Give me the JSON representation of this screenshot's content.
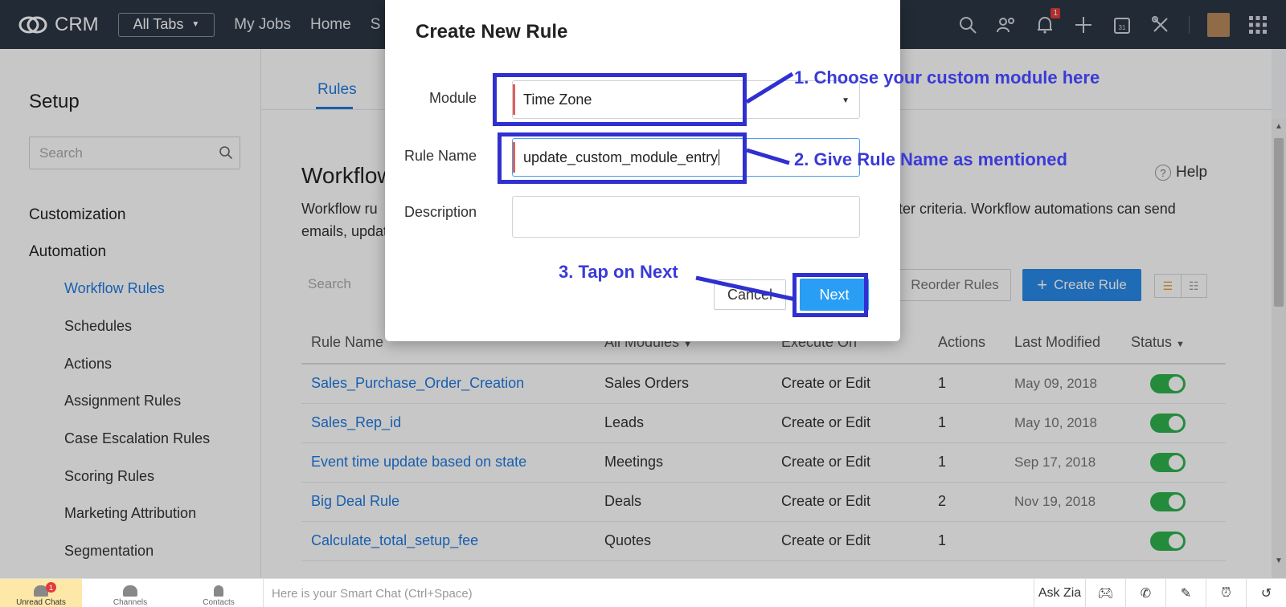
{
  "topbar": {
    "app_name": "CRM",
    "all_tabs": "All Tabs",
    "nav": [
      "My Jobs",
      "Home",
      "S"
    ],
    "notification_count": "1",
    "icons": [
      "search-icon",
      "contacts-icon",
      "bell-icon",
      "plus-icon",
      "calendar-icon",
      "setup-tools-icon",
      "avatar",
      "apps-grid-icon"
    ],
    "calendar_day": "31"
  },
  "sidebar": {
    "title": "Setup",
    "search_placeholder": "Search",
    "sections": [
      "Customization",
      "Automation"
    ],
    "items": [
      "Workflow Rules",
      "Schedules",
      "Actions",
      "Assignment Rules",
      "Case Escalation Rules",
      "Scoring Rules",
      "Marketing Attribution",
      "Segmentation"
    ]
  },
  "main": {
    "tab_rules": "Rules",
    "title": "Workflow",
    "desc_left_1": "Workflow ru",
    "desc_right_1": "filter criteria. Workflow automations can send",
    "desc_left_2": "emails, updat",
    "help": "Help",
    "search_placeholder": "Search",
    "reorder": "Reorder Rules",
    "create_rule": "Create Rule",
    "columns": [
      "Rule Name",
      "All Modules",
      "Execute On",
      "Actions",
      "Last Modified",
      "Status"
    ],
    "rows": [
      {
        "name": "Sales_Purchase_Order_Creation",
        "module": "Sales Orders",
        "execute": "Create or Edit",
        "actions": "1",
        "modified": "May 09, 2018"
      },
      {
        "name": "Sales_Rep_id",
        "module": "Leads",
        "execute": "Create or Edit",
        "actions": "1",
        "modified": "May 10, 2018"
      },
      {
        "name": "Event time update based on state",
        "module": "Meetings",
        "execute": "Create or Edit",
        "actions": "1",
        "modified": "Sep 17, 2018"
      },
      {
        "name": "Big Deal Rule",
        "module": "Deals",
        "execute": "Create or Edit",
        "actions": "2",
        "modified": "Nov 19, 2018"
      },
      {
        "name": "Calculate_total_setup_fee",
        "module": "Quotes",
        "execute": "Create or Edit",
        "actions": "1",
        "modified": ""
      }
    ]
  },
  "modal": {
    "title": "Create New Rule",
    "module_label": "Module",
    "module_value": "Time Zone",
    "rule_name_label": "Rule Name",
    "rule_name_value": "update_custom_module_entry",
    "description_label": "Description",
    "description_value": "",
    "cancel": "Cancel",
    "next": "Next"
  },
  "annotations": {
    "step1": "1. Choose your custom module here",
    "step2": "2. Give Rule Name as mentioned",
    "step3": "3. Tap on Next"
  },
  "bottombar": {
    "unread_chats": "Unread Chats",
    "unread_count": "1",
    "channels": "Channels",
    "contacts": "Contacts",
    "smart_chat": "Here is your Smart Chat (Ctrl+Space)",
    "ask_zia": "Ask Zia"
  },
  "colors": {
    "topbar": "#2c3645",
    "accent_blue": "#1f7ae0",
    "annotation": "#3030d0",
    "toggle_on": "#2fb34f"
  }
}
